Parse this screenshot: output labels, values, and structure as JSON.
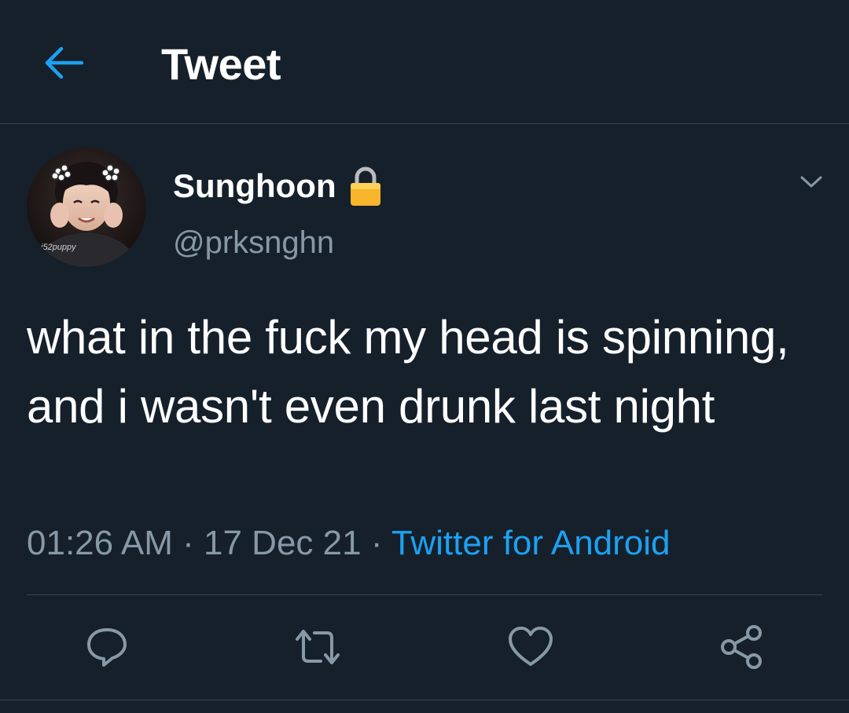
{
  "header": {
    "title": "Tweet",
    "back_icon": "arrow-left-icon",
    "accent_color": "#1da1f2"
  },
  "tweet": {
    "author": {
      "display_name": "Sunghoon",
      "username": "@prksnghn",
      "protected_icon": "lock-icon",
      "avatar_watermark": "i52puppy"
    },
    "text": "what in the fuck my head is spinning, and i wasn't even drunk last night",
    "time": "01:26 AM",
    "date": "17 Dec 21",
    "separator": " · ",
    "source": "Twitter for Android",
    "caret_icon": "chevron-down-icon"
  },
  "actions": [
    {
      "name": "reply",
      "icon": "reply-icon"
    },
    {
      "name": "retweet",
      "icon": "retweet-icon"
    },
    {
      "name": "like",
      "icon": "heart-icon"
    },
    {
      "name": "share",
      "icon": "share-icon"
    }
  ],
  "colors": {
    "background": "#15202b",
    "secondary_text": "#8899a6",
    "divider": "#38444d",
    "link": "#1da1f2"
  }
}
